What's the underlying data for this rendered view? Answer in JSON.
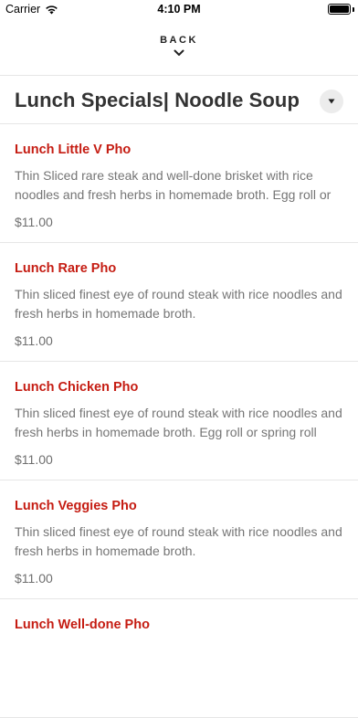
{
  "status_bar": {
    "carrier": "Carrier",
    "time": "4:10 PM",
    "battery_level": 1.0
  },
  "nav": {
    "back_label": "BACK",
    "chevron_icon": "chevron-down-icon"
  },
  "header": {
    "title": "Lunch Specials| Noodle Soup",
    "dropdown_icon": "caret-down-icon"
  },
  "colors": {
    "item_name": "#c51c12",
    "description": "#757575",
    "divider": "#e6e6e6"
  },
  "menu_items": [
    {
      "name": "Lunch Little V Pho",
      "description": "Thin Sliced rare steak and well-done brisket with rice noodles and fresh herbs in homemade broth. Egg roll or",
      "price": "$11.00"
    },
    {
      "name": "Lunch Rare Pho",
      "description": "Thin sliced finest eye of round steak with rice noodles and fresh herbs in homemade broth.",
      "price": "$11.00"
    },
    {
      "name": "Lunch Chicken Pho",
      "description": "Thin sliced finest eye of round steak with rice noodles and fresh herbs in homemade broth. Egg roll or spring roll",
      "price": "$11.00"
    },
    {
      "name": "Lunch Veggies Pho",
      "description": "Thin sliced finest eye of round steak with rice noodles and fresh herbs in homemade broth.",
      "price": "$11.00"
    },
    {
      "name": "Lunch Well-done Pho",
      "description": "",
      "price": ""
    }
  ]
}
